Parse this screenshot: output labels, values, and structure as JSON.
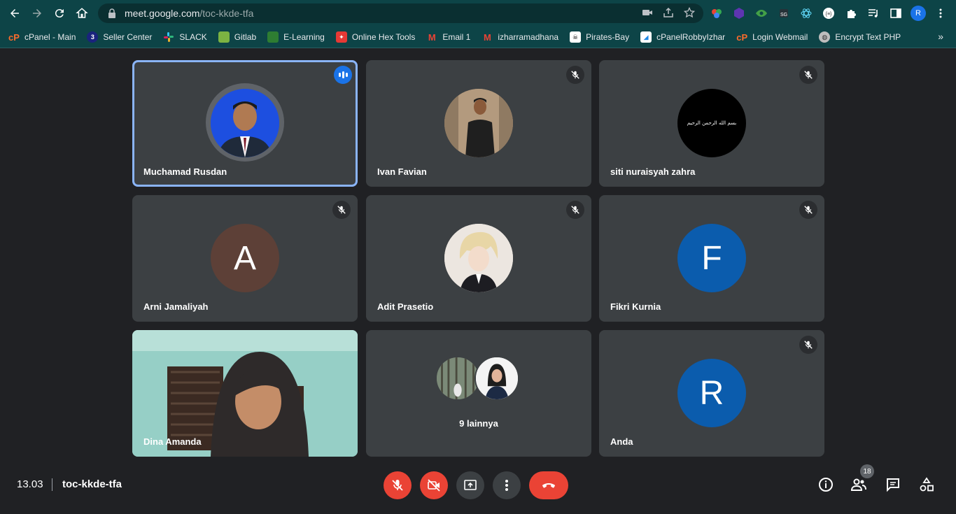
{
  "browser": {
    "url_host": "meet.google.com",
    "url_path": "/toc-kkde-tfa",
    "profile_initial": "R",
    "bookmarks": [
      {
        "label": "cPanel - Main",
        "icon": "cpanel-icon",
        "color": "#ff6c2c"
      },
      {
        "label": "Seller Center",
        "icon": "seller-center-icon",
        "color": "#1a237e"
      },
      {
        "label": "SLACK",
        "icon": "slack-icon",
        "color": "#4a154b"
      },
      {
        "label": "Gitlab",
        "icon": "gitlab-icon",
        "color": "#7cb342"
      },
      {
        "label": "E-Learning",
        "icon": "elearning-icon",
        "color": "#2e7d32"
      },
      {
        "label": "Online Hex Tools",
        "icon": "hex-tools-icon",
        "color": "#e53935"
      },
      {
        "label": "Email 1",
        "icon": "gmail-icon",
        "color": "#ea4335"
      },
      {
        "label": "izharramadhana",
        "icon": "gmail-icon",
        "color": "#ea4335"
      },
      {
        "label": "Pirates-Bay",
        "icon": "pirate-icon",
        "color": "#ffffff"
      },
      {
        "label": "cPanelRobbyIzhar",
        "icon": "link-icon",
        "color": "#1e88e5"
      },
      {
        "label": "Login Webmail",
        "icon": "cpanel-icon",
        "color": "#ff6c2c"
      },
      {
        "label": "Encrypt Text PHP",
        "icon": "globe-icon",
        "color": "#bdbdbd"
      }
    ]
  },
  "participants": [
    {
      "name": "Muchamad Rusdan",
      "avatar": "photo",
      "state": "speaking"
    },
    {
      "name": "Ivan Favian",
      "avatar": "photo",
      "state": "muted"
    },
    {
      "name": "siti nuraisyah zahra",
      "avatar": "photo",
      "state": "muted"
    },
    {
      "name": "Arni Jamaliyah",
      "avatar_letter": "A",
      "avatar_color": "#5d4037",
      "state": "muted"
    },
    {
      "name": "Adit Prasetio",
      "avatar": "photo",
      "state": "muted"
    },
    {
      "name": "Fikri Kurnia",
      "avatar_letter": "F",
      "avatar_color": "#0b5cad",
      "state": "muted"
    },
    {
      "name": "Dina Amanda",
      "avatar": "video",
      "state": "video"
    },
    {
      "name": "9 lainnya",
      "avatar": "group",
      "state": "others"
    },
    {
      "name": "Anda",
      "avatar_letter": "R",
      "avatar_color": "#0b5cad",
      "state": "muted"
    }
  ],
  "siti_avatar_text": "بسم الله الرحمن الرحيم",
  "bottom": {
    "time": "13.03",
    "meeting_code": "toc-kkde-tfa",
    "participant_count": "18"
  }
}
